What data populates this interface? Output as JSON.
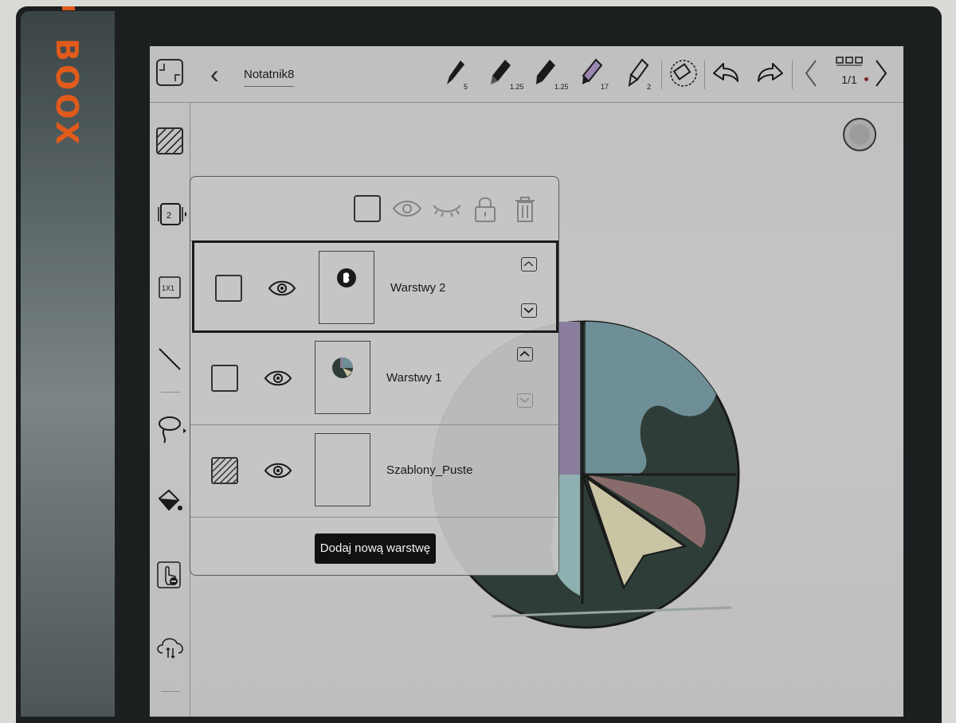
{
  "device": {
    "brand": "BOOX"
  },
  "toolbar": {
    "title": "Notatnik8",
    "pens": [
      {
        "icon": "brush-pen-icon",
        "size": "5"
      },
      {
        "icon": "pencil-icon",
        "size": "1.25"
      },
      {
        "icon": "ballpoint-pen-icon",
        "size": "1.25"
      },
      {
        "icon": "marker-pen-icon",
        "size": "17",
        "color": "#9a86b0"
      },
      {
        "icon": "fountain-pen-icon",
        "size": "2"
      }
    ],
    "page_indicator": "1/1"
  },
  "layers_panel": {
    "layers": [
      {
        "name": "Warstwy 2",
        "selected": true
      },
      {
        "name": "Warstwy 1",
        "selected": false
      },
      {
        "name": "Szablony_Puste",
        "selected": false
      }
    ],
    "add_button": "Dodaj nową warstwę"
  },
  "sidebar": {
    "items": [
      {
        "icon": "shrink-view-icon"
      },
      {
        "icon": "template-pattern-icon"
      },
      {
        "icon": "layers-icon",
        "badge": "2"
      },
      {
        "icon": "grid-1x1-icon",
        "label": "1X1"
      },
      {
        "icon": "line-shape-icon"
      },
      {
        "icon": "lasso-icon"
      },
      {
        "icon": "paint-bucket-icon"
      },
      {
        "icon": "touch-disable-icon"
      },
      {
        "icon": "cloud-sync-icon"
      }
    ]
  },
  "colors": {
    "screen": "#c2c3c2",
    "pie_blue": "#6f8f96",
    "pie_dark": "#2f3d38",
    "pie_purple": "#8b7d9c",
    "pie_rose": "#8a6b6b",
    "pie_cream": "#c9c4a4",
    "pie_teal": "#8fb0b0"
  }
}
